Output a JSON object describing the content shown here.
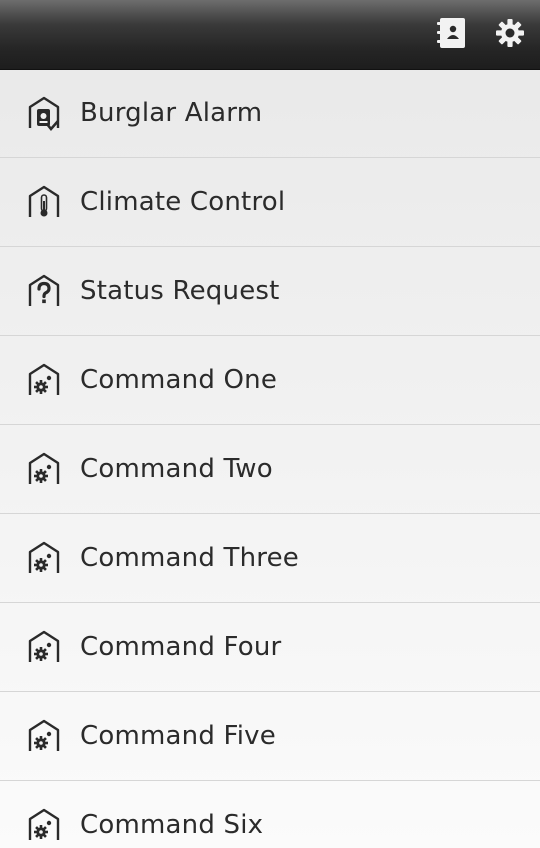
{
  "toolbar": {
    "contacts_icon": "address-book-icon",
    "settings_icon": "gear-icon"
  },
  "items": [
    {
      "label": "Burglar Alarm",
      "icon": "house-alarm-icon"
    },
    {
      "label": "Climate Control",
      "icon": "house-thermometer-icon"
    },
    {
      "label": "Status Request",
      "icon": "house-question-icon"
    },
    {
      "label": "Command One",
      "icon": "house-gear-icon"
    },
    {
      "label": "Command Two",
      "icon": "house-gear-icon"
    },
    {
      "label": "Command Three",
      "icon": "house-gear-icon"
    },
    {
      "label": "Command Four",
      "icon": "house-gear-icon"
    },
    {
      "label": "Command Five",
      "icon": "house-gear-icon"
    },
    {
      "label": "Command Six",
      "icon": "house-gear-icon"
    }
  ],
  "colors": {
    "topbar": "#262626",
    "text": "#2b2b2b",
    "divider": "#d6d6d6"
  }
}
